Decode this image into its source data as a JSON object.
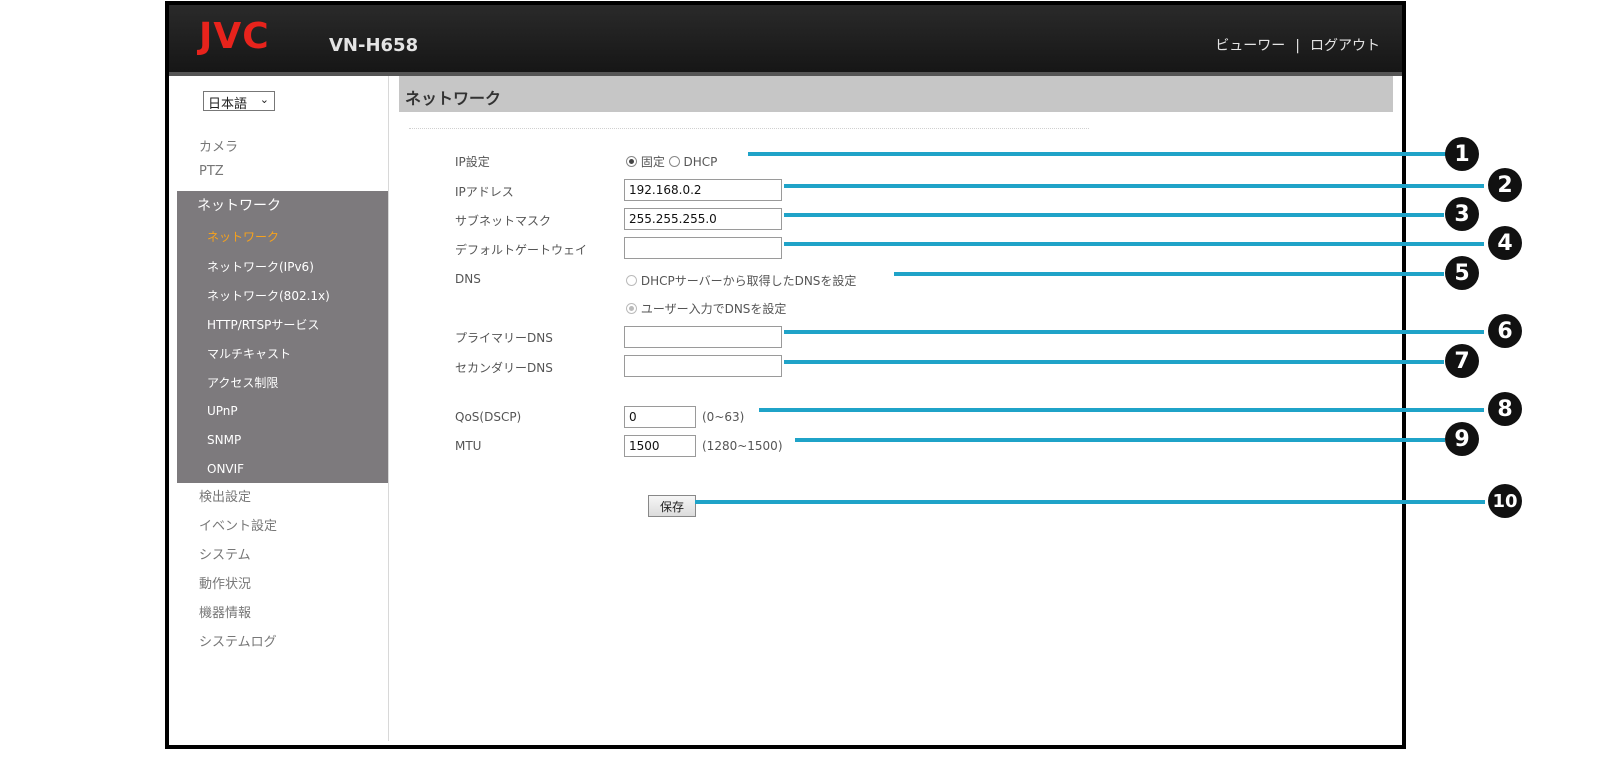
{
  "header": {
    "logo": "JVC",
    "model": "VN-H658",
    "viewer_link": "ビューワー",
    "separator": "|",
    "logout_link": "ログアウト"
  },
  "sidebar": {
    "language": "日本語",
    "items_top": [
      "カメラ",
      "PTZ"
    ],
    "network_header": "ネットワーク",
    "network_sub": [
      "ネットワーク",
      "ネットワーク(IPv6)",
      "ネットワーク(802.1x)",
      "HTTP/RTSPサービス",
      "マルチキャスト",
      "アクセス制限",
      "UPnP",
      "SNMP",
      "ONVIF"
    ],
    "items_bottom": [
      "検出設定",
      "イベント設定",
      "システム",
      "動作状況",
      "機器情報",
      "システムログ"
    ]
  },
  "page": {
    "title": "ネットワーク",
    "ip_setting_label": "IP設定",
    "ip_fixed": "固定",
    "ip_dhcp": "DHCP",
    "ip_address_label": "IPアドレス",
    "ip_address": "192.168.0.2",
    "subnet_label": "サブネットマスク",
    "subnet": "255.255.255.0",
    "gateway_label": "デフォルトゲートウェイ",
    "gateway": "",
    "dns_label": "DNS",
    "dns_from_dhcp": "DHCPサーバーから取得したDNSを設定",
    "dns_manual": "ユーザー入力でDNSを設定",
    "primary_dns_label": "プライマリーDNS",
    "primary_dns": "",
    "secondary_dns_label": "セカンダリーDNS",
    "secondary_dns": "",
    "qos_label": "QoS(DSCP)",
    "qos": "0",
    "qos_range": "(0~63)",
    "mtu_label": "MTU",
    "mtu": "1500",
    "mtu_range": "(1280~1500)",
    "save_label": "保存"
  },
  "callouts": [
    "1",
    "2",
    "3",
    "4",
    "5",
    "6",
    "7",
    "8",
    "9",
    "10"
  ],
  "colors": {
    "brand_red": "#e8231c",
    "callout_line": "#1fa3c8",
    "active_nav": "#f7a21c",
    "nav_block_bg": "#7d7a7d"
  }
}
